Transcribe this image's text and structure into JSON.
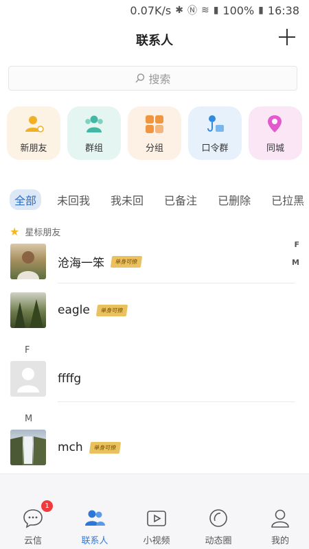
{
  "status": {
    "speed": "0.07K/s",
    "battery": "100%",
    "time": "16:38"
  },
  "header": {
    "title": "联系人"
  },
  "search": {
    "placeholder": "搜索"
  },
  "quick": [
    {
      "label": "新朋友",
      "bg": "#fdf3e4",
      "color": "#f0b023"
    },
    {
      "label": "群组",
      "bg": "#e5f5f1",
      "color": "#43b7a4"
    },
    {
      "label": "分组",
      "bg": "#fdf1e6",
      "color": "#f09640"
    },
    {
      "label": "口令群",
      "bg": "#e6f1fb",
      "color": "#3389dc"
    },
    {
      "label": "同城",
      "bg": "#fbe6f6",
      "color": "#e25acb"
    }
  ],
  "filters": [
    "全部",
    "未回我",
    "我未回",
    "已备注",
    "已删除",
    "已拉黑"
  ],
  "starred": {
    "label": "星标朋友"
  },
  "contacts": {
    "star1": {
      "name": "沧海一笨",
      "badge": "单身可撩"
    },
    "star2": {
      "name": "eagle",
      "badge": "单身可撩"
    },
    "f_head": "F",
    "f1": {
      "name": "ffffg"
    },
    "m_head": "M",
    "m1": {
      "name": "mch",
      "badge": "单身可撩"
    }
  },
  "index": [
    "F",
    "M"
  ],
  "tabs": [
    {
      "label": "云信",
      "badge": "1"
    },
    {
      "label": "联系人"
    },
    {
      "label": "小视频"
    },
    {
      "label": "动态圈"
    },
    {
      "label": "我的"
    }
  ],
  "colors": {
    "accent": "#2d78d6",
    "badge_red": "#ef3b3b"
  }
}
